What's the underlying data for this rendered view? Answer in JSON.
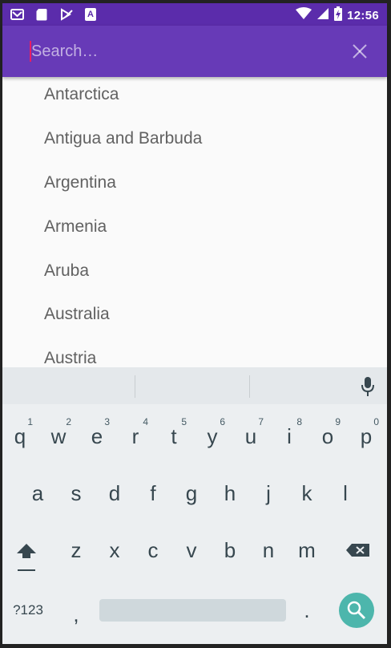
{
  "status_bar": {
    "time": "12:56",
    "left_icons": [
      "gmail-icon",
      "sd-card-icon",
      "flag-icon",
      "a-icon"
    ],
    "right_icons": [
      "wifi-icon",
      "signal-icon",
      "battery-charging-icon"
    ],
    "a_icon_letter": "A",
    "background": "#5b2cab"
  },
  "app_bar": {
    "background": "#673ab7",
    "search": {
      "value": "",
      "placeholder": "Search…"
    },
    "close_icon": "close-icon"
  },
  "list": {
    "items": [
      "Antarctica",
      "Antigua and Barbuda",
      "Argentina",
      "Armenia",
      "Aruba",
      "Australia",
      "Austria"
    ]
  },
  "keyboard": {
    "row1": [
      {
        "key": "q",
        "hint": "1"
      },
      {
        "key": "w",
        "hint": "2"
      },
      {
        "key": "e",
        "hint": "3"
      },
      {
        "key": "r",
        "hint": "4"
      },
      {
        "key": "t",
        "hint": "5"
      },
      {
        "key": "y",
        "hint": "6"
      },
      {
        "key": "u",
        "hint": "7"
      },
      {
        "key": "i",
        "hint": "8"
      },
      {
        "key": "o",
        "hint": "9"
      },
      {
        "key": "p",
        "hint": "0"
      }
    ],
    "row2": [
      "a",
      "s",
      "d",
      "f",
      "g",
      "h",
      "j",
      "k",
      "l"
    ],
    "row3": [
      "z",
      "x",
      "c",
      "v",
      "b",
      "n",
      "m"
    ],
    "symbols_label": "?123",
    "comma": ",",
    "period": ".",
    "icons": {
      "mic": "microphone-icon",
      "shift": "shift-icon",
      "backspace": "backspace-icon",
      "search": "search-icon"
    },
    "search_fab_color": "#4db6ac"
  }
}
